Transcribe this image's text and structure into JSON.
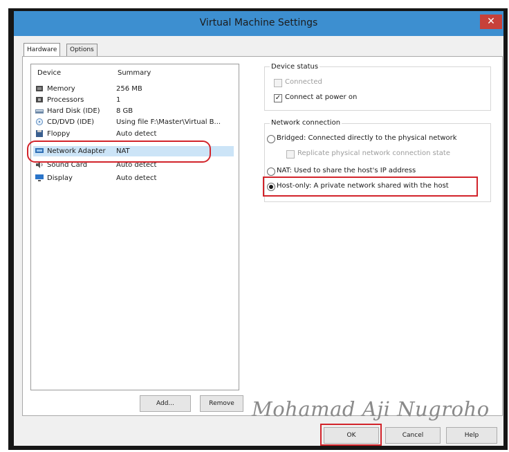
{
  "window": {
    "title": "Virtual Machine Settings",
    "close_glyph": "✕"
  },
  "tabs": [
    {
      "label": "Hardware",
      "active": true
    },
    {
      "label": "Options",
      "active": false
    }
  ],
  "device_list": {
    "header_device": "Device",
    "header_summary": "Summary",
    "rows": [
      {
        "name": "Memory",
        "summary": "256 MB",
        "icon": "memory-icon"
      },
      {
        "name": "Processors",
        "summary": "1",
        "icon": "processor-icon"
      },
      {
        "name": "Hard Disk (IDE)",
        "summary": "8 GB",
        "icon": "hard-disk-icon"
      },
      {
        "name": "CD/DVD (IDE)",
        "summary": "Using file F:\\Master\\Virtual B...",
        "icon": "cd-dvd-icon"
      },
      {
        "name": "Floppy",
        "summary": "Auto detect",
        "icon": "floppy-icon"
      },
      {
        "name": "Network Adapter",
        "summary": "NAT",
        "icon": "network-adapter-icon",
        "selected": true
      },
      {
        "name": "Sound Card",
        "summary": "Auto detect",
        "icon": "sound-card-icon"
      },
      {
        "name": "Display",
        "summary": "Auto detect",
        "icon": "display-icon"
      }
    ]
  },
  "device_status": {
    "label": "Device status",
    "connected": {
      "label": "Connected",
      "checked": false,
      "enabled": false
    },
    "connect_at_power_on": {
      "label": "Connect at power on",
      "checked": true
    }
  },
  "network_connection": {
    "label": "Network connection",
    "bridged": {
      "label": "Bridged: Connected directly to the physical network",
      "checked": false
    },
    "replicate": {
      "label": "Replicate physical network connection state",
      "checked": false,
      "enabled": false
    },
    "nat": {
      "label": "NAT: Used to share the host's IP address",
      "checked": false
    },
    "host_only": {
      "label": "Host-only: A private network shared with the host",
      "checked": true
    }
  },
  "buttons": {
    "add": "Add...",
    "remove": "Remove",
    "ok": "OK",
    "cancel": "Cancel",
    "help": "Help"
  },
  "watermark": "Mohamad Aji Nugroho",
  "colors": {
    "titlebar": "#3d8fd0",
    "close": "#c7413a",
    "annotation_red": "#d2232a",
    "selection": "#cce4f7"
  }
}
